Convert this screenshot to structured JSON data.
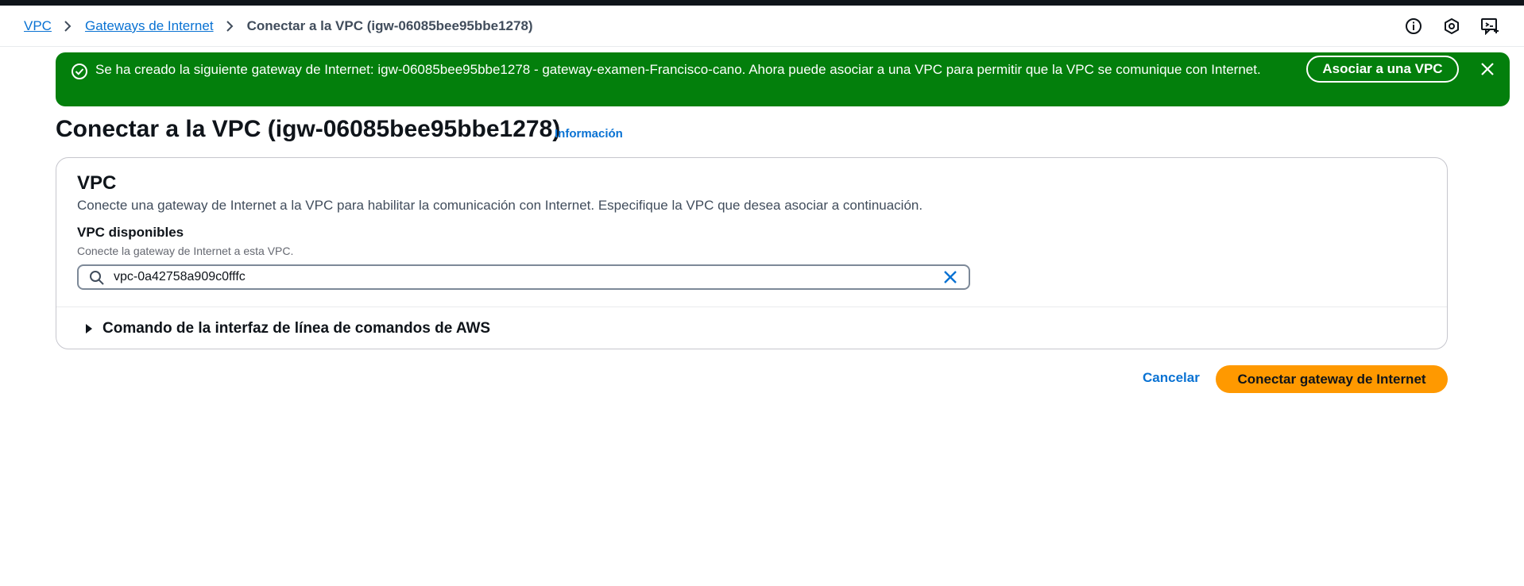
{
  "breadcrumb": {
    "items": [
      "VPC",
      "Gateways de Internet"
    ],
    "current": "Conectar a la VPC (igw-06085bee95bbe1278)"
  },
  "header_icons": [
    "info-icon",
    "settings-icon",
    "feedback-icon"
  ],
  "flash": {
    "message": "Se ha creado la siguiente gateway de Internet: igw-06085bee95bbe1278 - gateway-examen-Francisco-cano. Ahora puede asociar a una VPC para permitir que la VPC se comunique con Internet.",
    "action_label": "Asociar a una VPC",
    "color": "#037f0c"
  },
  "page": {
    "title": "Conectar a la VPC (igw-06085bee95bbe1278)",
    "info_label": "Información"
  },
  "vpc_section": {
    "title": "VPC",
    "description": "Conecte una gateway de Internet a la VPC para habilitar la comunicación con Internet. Especifique la VPC que desea asociar a continuación.",
    "field_label": "VPC disponibles",
    "field_description": "Conecte la gateway de Internet a esta VPC.",
    "search_value": "vpc-0a42758a909c0fffc"
  },
  "cli_expander": {
    "label": "Comando de la interfaz de línea de comandos de AWS"
  },
  "actions": {
    "cancel_label": "Cancelar",
    "primary_label": "Conectar gateway de Internet",
    "primary_color": "#ff9900"
  }
}
